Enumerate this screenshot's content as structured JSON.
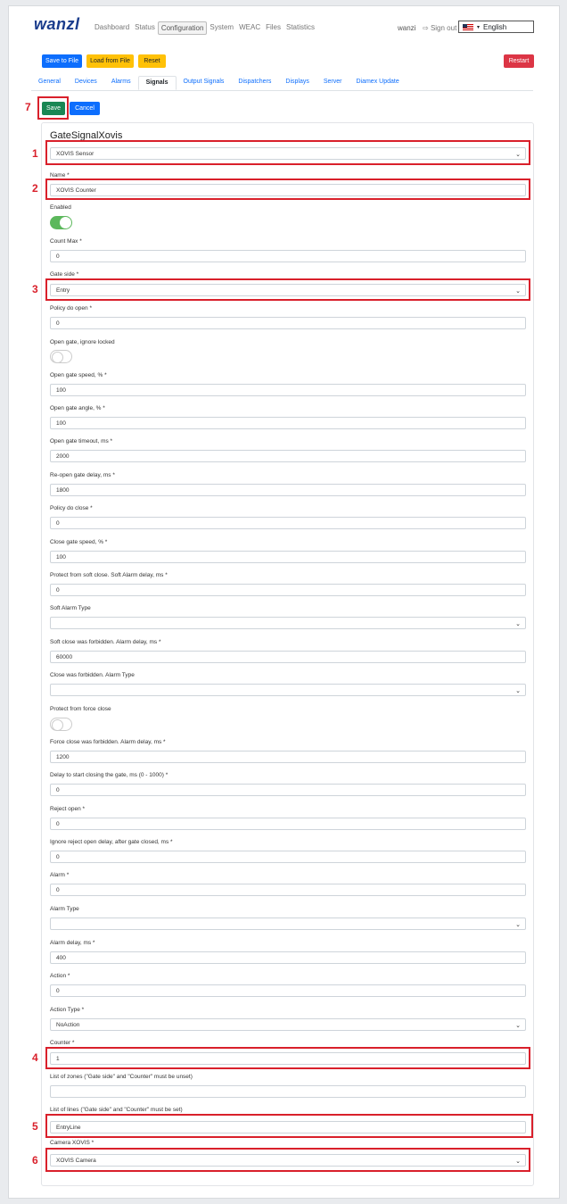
{
  "header": {
    "logo": "wanzl",
    "nav": [
      "Dashboard",
      "Status",
      "Configuration",
      "System",
      "WEAC",
      "Files",
      "Statistics"
    ],
    "user": "wanzi",
    "sign_out": "Sign out",
    "language": "English"
  },
  "toolbar": {
    "save_to_file": "Save to File",
    "load_from_file": "Load from File",
    "reset": "Reset",
    "restart": "Restart"
  },
  "tabs": [
    "General",
    "Devices",
    "Alarms",
    "Signals",
    "Output Signals",
    "Dispatchers",
    "Displays",
    "Server",
    "Diamex Update"
  ],
  "form_actions": {
    "save": "Save",
    "cancel": "Cancel"
  },
  "card_title": "GateSignalXovis",
  "signal_type": "XOVIS Sensor",
  "fields": {
    "name": {
      "label": "Name *",
      "value": "XOVIS Counter"
    },
    "enabled": {
      "label": "Enabled",
      "on": true
    },
    "count_max": {
      "label": "Count Max *",
      "value": "0"
    },
    "gate_side": {
      "label": "Gate side *",
      "value": "Entry"
    },
    "policy_open": {
      "label": "Policy do open *",
      "value": "0"
    },
    "ignore_locked": {
      "label": "Open gate, ignore locked",
      "on": false
    },
    "open_speed": {
      "label": "Open gate speed, % *",
      "value": "100"
    },
    "open_angle": {
      "label": "Open gate angle, % *",
      "value": "100"
    },
    "open_timeout": {
      "label": "Open gate timeout, ms *",
      "value": "2000"
    },
    "reopen_delay": {
      "label": "Re-open gate delay, ms *",
      "value": "1800"
    },
    "policy_close": {
      "label": "Policy do close *",
      "value": "0"
    },
    "close_speed": {
      "label": "Close gate speed, % *",
      "value": "100"
    },
    "soft_close_delay": {
      "label": "Protect from soft close. Soft Alarm delay, ms *",
      "value": "0"
    },
    "soft_alarm_type": {
      "label": "Soft Alarm Type",
      "value": ""
    },
    "soft_forbidden_delay": {
      "label": "Soft close was forbidden. Alarm delay, ms *",
      "value": "60000"
    },
    "close_forbidden_type": {
      "label": "Close was forbidden. Alarm Type",
      "value": ""
    },
    "force_close": {
      "label": "Protect from force close",
      "on": false
    },
    "force_forbidden_delay": {
      "label": "Force close was forbidden. Alarm delay, ms *",
      "value": "1200"
    },
    "start_close_delay": {
      "label": "Delay to start closing the gate, ms (0 - 1000) *",
      "value": "0"
    },
    "reject_open": {
      "label": "Reject open *",
      "value": "0"
    },
    "ignore_reject_delay": {
      "label": "Ignore reject open delay, after gate closed, ms *",
      "value": "0"
    },
    "alarm": {
      "label": "Alarm *",
      "value": "0"
    },
    "alarm_type": {
      "label": "Alarm Type",
      "value": ""
    },
    "alarm_delay": {
      "label": "Alarm delay, ms *",
      "value": "400"
    },
    "action": {
      "label": "Action *",
      "value": "0"
    },
    "action_type": {
      "label": "Action Type *",
      "value": "NoAction"
    },
    "counter": {
      "label": "Counter *",
      "value": "1"
    },
    "zones": {
      "label": "List of zones (\"Gate side\" and \"Counter\" must be unset)",
      "value": ""
    },
    "lines": {
      "label": "List of lines (\"Gate side\" and \"Counter\" must be set)",
      "value": "EntryLine"
    },
    "camera": {
      "label": "Camera XOVIS *",
      "value": "XOVIS Camera"
    }
  },
  "annotations": [
    "1",
    "2",
    "3",
    "4",
    "5",
    "6",
    "7"
  ],
  "colors": {
    "highlight": "#d9202b",
    "primary": "#0d6efd",
    "save": "#198754",
    "toggle_on": "#5cb85c"
  }
}
